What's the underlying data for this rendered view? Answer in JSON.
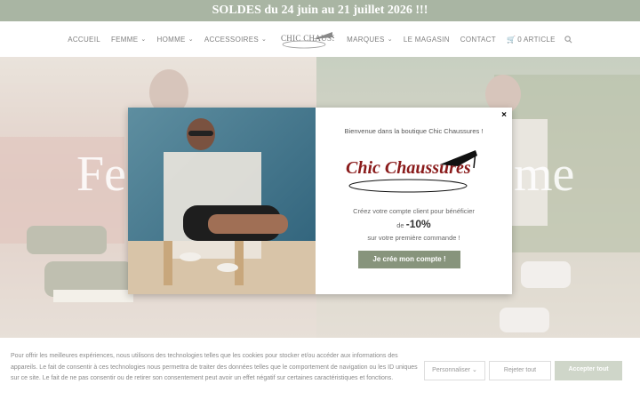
{
  "promo": {
    "text": "SOLDES du 24 juin au 21 juillet 2026 !!!"
  },
  "nav": {
    "items": [
      "ACCUEIL",
      "FEMME",
      "HOMME",
      "ACCESSOIRES",
      "MARQUES",
      "LE MAGASIN",
      "CONTACT"
    ],
    "logo_text": "Chic Chaussures",
    "cart_label": "0 article"
  },
  "hero": {
    "left_word": "Fe",
    "right_word": "me"
  },
  "modal": {
    "welcome": "Bienvenue dans la boutique Chic Chaussures !",
    "logo_text": "Chic Chaussures",
    "line1": "Créez votre compte client pour bénéficier",
    "line2_prefix": "de",
    "discount": "-10%",
    "line3": "sur votre première commande !",
    "cta": "Je crée mon compte !"
  },
  "cookie": {
    "text": "Pour offrir les meilleures expériences, nous utilisons des technologies telles que les cookies pour stocker et/ou accéder aux informations des appareils. Le fait de consentir à ces technologies nous permettra de traiter des données telles que le comportement de navigation ou les ID uniques sur ce site. Le fait de ne pas consentir ou de retirer son consentement peut avoir un effet négatif sur certaines caractéristiques et fonctions.",
    "customize": "Personnaliser",
    "reject": "Rejeter tout",
    "accept": "Accepter tout"
  },
  "colors": {
    "promo_bg": "#a9b5a3",
    "cta_bg": "#87947c",
    "accept_bg": "#cfd6c9"
  }
}
